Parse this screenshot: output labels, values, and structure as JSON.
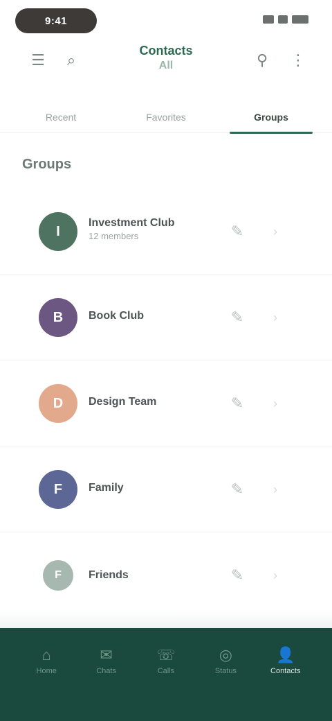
{
  "status_bar": {
    "time": "9:41",
    "icons": [
      "signal-icon",
      "wifi-icon",
      "battery-icon"
    ]
  },
  "app_bar": {
    "title": "Contacts",
    "subtitle": "All",
    "left_icons": [
      "menu-icon",
      "search-icon"
    ],
    "right_icons": [
      "filter-icon",
      "more-icon"
    ]
  },
  "tabs": [
    {
      "label": "Recent",
      "active": false
    },
    {
      "label": "Favorites",
      "active": false
    },
    {
      "label": "Groups",
      "active": true
    }
  ],
  "section": {
    "title": "Groups"
  },
  "groups": [
    {
      "name": "Investment Club",
      "sub": "12 members",
      "initial": "I",
      "color": "#4f7361"
    },
    {
      "name": "Book Club",
      "sub": "",
      "initial": "B",
      "color": "#6c5682"
    },
    {
      "name": "Design Team",
      "sub": "",
      "initial": "D",
      "color": "#e3a98d"
    },
    {
      "name": "Family",
      "sub": "",
      "initial": "F",
      "color": "#5d6796"
    },
    {
      "name": "Friends",
      "sub": "",
      "initial": "F",
      "color": "#a7b8b0"
    }
  ],
  "bottom_nav": [
    {
      "label": "Home",
      "icon": "home-icon",
      "active": false
    },
    {
      "label": "Chats",
      "icon": "chat-icon",
      "active": false
    },
    {
      "label": "Calls",
      "icon": "phone-icon",
      "active": false
    },
    {
      "label": "Status",
      "icon": "status-icon",
      "active": false
    },
    {
      "label": "Contacts",
      "icon": "person-icon",
      "active": true
    }
  ],
  "colors": {
    "accent": "#2e6a52",
    "nav_background": "#1a4a3d"
  }
}
